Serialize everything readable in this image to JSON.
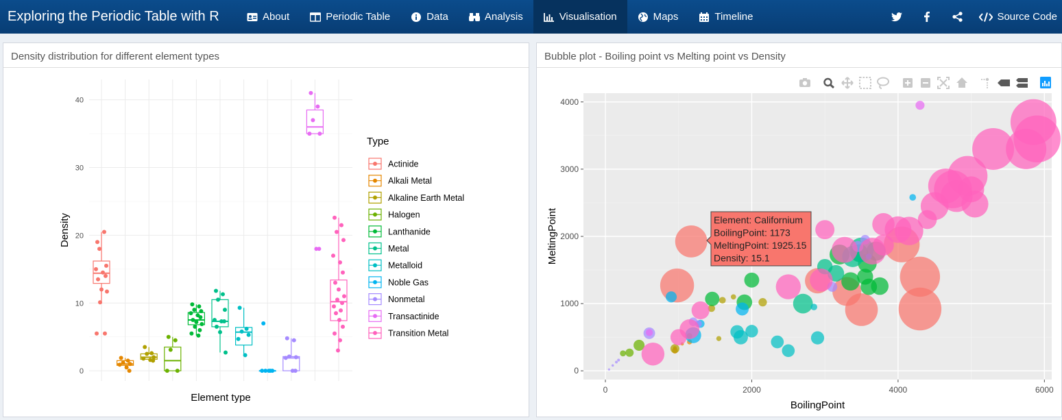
{
  "app": {
    "title": "Exploring the Periodic Table with R"
  },
  "nav": {
    "items": [
      {
        "key": "about",
        "label": "About",
        "icon": "id-card-icon"
      },
      {
        "key": "periodic",
        "label": "Periodic Table",
        "icon": "table-icon"
      },
      {
        "key": "data",
        "label": "Data",
        "icon": "info-circle-icon"
      },
      {
        "key": "analysis",
        "label": "Analysis",
        "icon": "binoculars-icon"
      },
      {
        "key": "visualisation",
        "label": "Visualisation",
        "icon": "bar-chart-icon",
        "active": true
      },
      {
        "key": "maps",
        "label": "Maps",
        "icon": "globe-icon"
      },
      {
        "key": "timeline",
        "label": "Timeline",
        "icon": "calendar-icon"
      }
    ],
    "social": [
      "twitter-icon",
      "facebook-icon",
      "share-icon"
    ],
    "source_label": "Source Code"
  },
  "left_panel": {
    "title": "Density distribution for different element types"
  },
  "right_panel": {
    "title": "Bubble plot - Boiling point vs Melting point vs Density"
  },
  "colors": {
    "navbar": "#0b4c8c",
    "active_tab": "#06325e",
    "plot_bg": "#ebebeb"
  },
  "modebar_icons": [
    "camera-icon",
    "zoom-icon",
    "pan-icon",
    "box-select-icon",
    "lasso-icon",
    "zoom-in-icon",
    "zoom-out-icon",
    "autoscale-icon",
    "reset-axes-icon",
    "spike-lines-icon",
    "hover-closest-icon",
    "hover-compare-icon",
    "plotly-logo-icon"
  ],
  "chart_data": [
    {
      "type": "box",
      "xlabel": "Element type",
      "ylabel": "Density",
      "yticks": [
        0,
        10,
        20,
        30,
        40
      ],
      "ylim": [
        -1.5,
        43
      ],
      "grid": true,
      "legend": {
        "title": "Type",
        "placement": "right"
      },
      "series": [
        {
          "name": "Actinide",
          "color": "#f8766d",
          "box": [
            9.9,
            12.9,
            14.4,
            16.2,
            20.5
          ],
          "points": [
            19.0,
            20.5,
            18.0,
            15.5,
            15.0,
            14.5,
            14.0,
            13.5,
            12.0,
            11.7,
            10.1,
            5.5,
            5.5
          ]
        },
        {
          "name": "Alkali Metal",
          "color": "#e58700",
          "box": [
            0.5,
            0.8,
            1.0,
            1.5,
            1.9
          ],
          "points": [
            1.9,
            1.5,
            1.2,
            1.0,
            0.9,
            0.5,
            0.0
          ]
        },
        {
          "name": "Alkaline Earth Metal",
          "color": "#b0a000",
          "box": [
            1.5,
            1.7,
            2.0,
            2.5,
            3.5
          ],
          "points": [
            3.5,
            2.6,
            2.5,
            2.0,
            1.8,
            1.6,
            1.5
          ]
        },
        {
          "name": "Halogen",
          "color": "#6bb100",
          "box": [
            0.0,
            0.0,
            1.5,
            3.5,
            5.0
          ],
          "points": [
            5.0,
            4.5,
            3.1,
            0.0,
            0.0
          ]
        },
        {
          "name": "Lanthanide",
          "color": "#00ba38",
          "box": [
            5.2,
            6.8,
            7.5,
            8.6,
            9.8
          ],
          "points": [
            9.8,
            9.5,
            9.0,
            8.8,
            8.5,
            8.2,
            7.9,
            7.5,
            7.2,
            6.9,
            6.5,
            6.0,
            5.5,
            5.2
          ]
        },
        {
          "name": "Metal",
          "color": "#00c08b",
          "box": [
            2.7,
            6.5,
            7.3,
            10.5,
            11.8
          ],
          "points": [
            11.8,
            11.3,
            10.5,
            9.0,
            7.5,
            7.3,
            7.3,
            6.5,
            5.7,
            2.7
          ]
        },
        {
          "name": "Metalloid",
          "color": "#00bfc4",
          "box": [
            2.3,
            3.8,
            5.7,
            6.4,
            9.3
          ],
          "points": [
            9.3,
            6.2,
            5.8,
            5.3,
            4.7,
            2.3
          ]
        },
        {
          "name": "Noble Gas",
          "color": "#00b4f0",
          "box": [
            0.0,
            0.0,
            0.0,
            0.0,
            0.0
          ],
          "points": [
            7.0,
            0.0,
            0.0,
            0.0,
            0.0,
            0.0
          ]
        },
        {
          "name": "Nonmetal",
          "color": "#a58aff",
          "box": [
            0.0,
            0.0,
            1.9,
            2.1,
            4.8
          ],
          "points": [
            4.8,
            4.5,
            2.1,
            2.0,
            1.9,
            0.0,
            0.0
          ]
        },
        {
          "name": "Transactinide",
          "color": "#e76bf3",
          "box": [
            35.0,
            35.0,
            36.0,
            38.5,
            41.0
          ],
          "points": [
            41.0,
            39.0,
            37.0,
            35.0,
            35.0,
            18.0,
            18.0
          ]
        },
        {
          "name": "Transition Metal",
          "color": "#ff62bc",
          "box": [
            3.0,
            7.4,
            10.2,
            13.4,
            22.6
          ],
          "points": [
            22.6,
            21.5,
            20.5,
            19.3,
            17.0,
            16.0,
            14.5,
            13.0,
            12.0,
            11.0,
            10.5,
            10.0,
            9.5,
            8.9,
            8.5,
            7.5,
            6.5,
            5.5,
            4.5,
            3.0
          ]
        }
      ]
    },
    {
      "type": "scatter",
      "xlabel": "BoilingPoint",
      "ylabel": "MeltingPoint",
      "xlim": [
        -300,
        6100
      ],
      "ylim": [
        -130,
        4130
      ],
      "xticks": [
        0,
        2000,
        4000,
        6000
      ],
      "yticks": [
        0,
        1000,
        2000,
        3000,
        4000
      ],
      "grid": true,
      "tooltip": {
        "lines": [
          "Element: Californium",
          "BoilingPoint: 1173",
          "MeltingPoint: 1925.15",
          "Density: 15.1"
        ]
      },
      "series": [
        {
          "name": "Actinide",
          "color": "#f8766d",
          "points": [
            [
              1173,
              1925,
              15.1
            ],
            [
              980,
              1270,
              16.0
            ],
            [
              2900,
              1340,
              11.7
            ],
            [
              3500,
              910,
              15.4
            ],
            [
              4300,
              1400,
              19.1
            ],
            [
              4300,
              920,
              20.5
            ],
            [
              4050,
              1880,
              17.0
            ],
            [
              3300,
              1180,
              13.5
            ]
          ]
        },
        {
          "name": "Alkali Metal",
          "color": "#e58700",
          "points": [
            [
              1050,
              400,
              0.6
            ],
            [
              950,
              340,
              0.9
            ],
            [
              1150,
              430,
              1.5
            ],
            [
              950,
              300,
              1.9
            ]
          ]
        },
        {
          "name": "Alkaline Earth Metal",
          "color": "#b0a000",
          "points": [
            [
              1750,
              1100,
              1.6
            ],
            [
              1600,
              1050,
              2.3
            ],
            [
              2150,
              1020,
              3.2
            ],
            [
              1150,
              520,
              1.8
            ],
            [
              1450,
              930,
              2.6
            ],
            [
              1550,
              480,
              1.5
            ],
            [
              950,
              330,
              3.5
            ]
          ]
        },
        {
          "name": "Halogen",
          "color": "#6bb100",
          "points": [
            [
              240,
              260,
              2.0
            ],
            [
              330,
              270,
              3.1
            ],
            [
              460,
              380,
              4.5
            ]
          ]
        },
        {
          "name": "Lanthanide",
          "color": "#00ba38",
          "points": [
            [
              1460,
              1070,
              6.2
            ],
            [
              2000,
              1350,
              6.5
            ],
            [
              3550,
              1400,
              7.0
            ],
            [
              3750,
              1260,
              7.8
            ],
            [
              3580,
              1600,
              8.4
            ],
            [
              3470,
              1750,
              7.9
            ],
            [
              3700,
              1780,
              8.6
            ],
            [
              3200,
              1730,
              9.0
            ],
            [
              3350,
              1330,
              8.2
            ],
            [
              3600,
              1250,
              7.2
            ],
            [
              1900,
              1020,
              6.8
            ]
          ]
        },
        {
          "name": "Metal",
          "color": "#00c08b",
          "points": [
            [
              3000,
              1550,
              6.7
            ],
            [
              3150,
              1450,
              7.3
            ],
            [
              3380,
              1700,
              9.6
            ],
            [
              3500,
              1800,
              11.3
            ],
            [
              2700,
              1000,
              8.9
            ]
          ]
        },
        {
          "name": "Metalloid",
          "color": "#00bfc4",
          "points": [
            [
              1800,
              580,
              5.7
            ],
            [
              1850,
              500,
              6.2
            ],
            [
              2000,
              590,
              5.3
            ],
            [
              2350,
              430,
              5.4
            ],
            [
              2500,
              300,
              5.4
            ],
            [
              2900,
              490,
              5.6
            ],
            [
              2850,
              950,
              2.3
            ]
          ]
        },
        {
          "name": "Noble Gas",
          "color": "#00b4f0",
          "points": [
            [
              900,
              1100,
              4.5
            ],
            [
              1200,
              530,
              7.0
            ],
            [
              1300,
              700,
              3.0
            ],
            [
              1870,
              920,
              5.5
            ],
            [
              3600,
              1700,
              2.0
            ],
            [
              4200,
              2580,
              2.3
            ]
          ]
        },
        {
          "name": "Nonmetal",
          "color": "#a58aff",
          "points": [
            [
              600,
              560,
              4.8
            ],
            [
              1200,
              730,
              3.3
            ],
            [
              1270,
              700,
              2.5
            ],
            [
              50,
              20,
              0.1
            ],
            [
              100,
              80,
              0.2
            ],
            [
              150,
              130,
              0.3
            ],
            [
              180,
              160,
              0.4
            ],
            [
              3100,
              1250,
              4.0
            ],
            [
              3450,
              1850,
              4.5
            ],
            [
              3550,
              1950,
              3.8
            ]
          ]
        },
        {
          "name": "Transactinide",
          "color": "#e76bf3",
          "points": [
            [
              4300,
              3950,
              3.5
            ],
            [
              600,
              570,
              2.5
            ]
          ]
        },
        {
          "name": "Transition Metal",
          "color": "#ff62bc",
          "points": [
            [
              1000,
              500,
              7.1
            ],
            [
              1150,
              620,
              8.9
            ],
            [
              650,
              250,
              10.5
            ],
            [
              2500,
              1250,
              11.5
            ],
            [
              3270,
              1800,
              12.0
            ],
            [
              3000,
              2100,
              8.6
            ],
            [
              3650,
              1780,
              12.4
            ],
            [
              2950,
              1350,
              10.5
            ],
            [
              3800,
              2180,
              10.2
            ],
            [
              4000,
              2100,
              12.4
            ],
            [
              4150,
              2080,
              13.3
            ],
            [
              4500,
              2450,
              13.0
            ],
            [
              4800,
              2600,
              15.0
            ],
            [
              4750,
              2700,
              18.0
            ],
            [
              4650,
              2750,
              16.5
            ],
            [
              4950,
              2900,
              19.0
            ],
            [
              5000,
              2700,
              12.0
            ],
            [
              5050,
              2480,
              12.5
            ],
            [
              5300,
              3300,
              20.0
            ],
            [
              5750,
              3300,
              19.3
            ],
            [
              5850,
              3700,
              22.0
            ],
            [
              5900,
              3450,
              22.6
            ],
            [
              4400,
              2250,
              8.5
            ],
            [
              3800,
              1870,
              9.5
            ],
            [
              1300,
              900,
              8.0
            ]
          ]
        }
      ]
    }
  ]
}
